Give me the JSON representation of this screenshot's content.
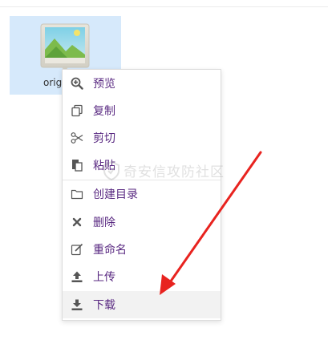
{
  "file": {
    "name": "orig",
    "icon": "image-file-icon"
  },
  "context_menu": {
    "items": [
      {
        "label": "预览",
        "icon": "zoom-in-icon"
      },
      {
        "label": "复制",
        "icon": "copy-icon"
      },
      {
        "label": "剪切",
        "icon": "scissors-icon"
      },
      {
        "label": "粘贴",
        "icon": "paste-icon"
      },
      {
        "label": "创建目录",
        "icon": "folder-icon"
      },
      {
        "label": "删除",
        "icon": "delete-x-icon"
      },
      {
        "label": "重命名",
        "icon": "edit-icon"
      },
      {
        "label": "上传",
        "icon": "upload-icon"
      },
      {
        "label": "下载",
        "icon": "download-icon"
      }
    ],
    "hovered_item": "下载"
  },
  "watermark": {
    "text": "奇安信攻防社区"
  },
  "colors": {
    "menu_text": "#5a2a82",
    "selection_bg": "#d6e9fb",
    "arrow": "#e8231f"
  }
}
